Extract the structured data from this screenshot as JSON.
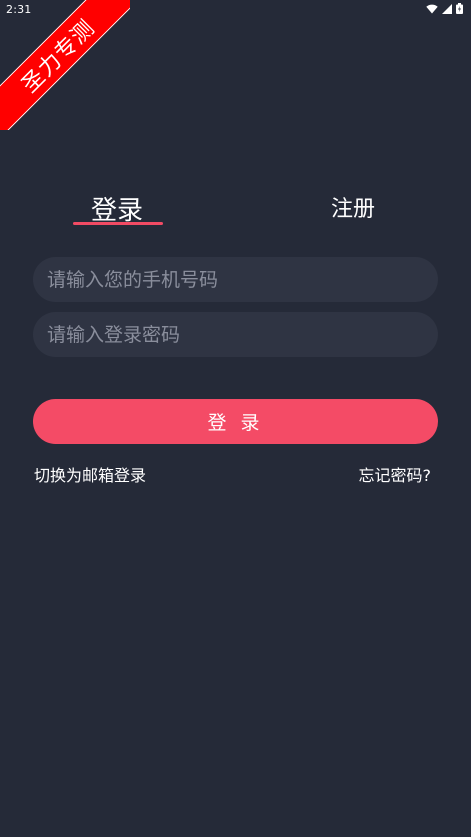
{
  "status_bar": {
    "time": "2:31",
    "icons": [
      "wifi-icon",
      "signal-icon",
      "battery-icon"
    ]
  },
  "ribbon": {
    "text": "圣力专测",
    "color": "#ff0000"
  },
  "tabs": {
    "login_label": "登录",
    "register_label": "注册",
    "active": "login"
  },
  "form": {
    "phone_placeholder": "请输入您的手机号码",
    "phone_value": "",
    "password_placeholder": "请输入登录密码",
    "password_value": ""
  },
  "login_button": {
    "label": "登 录"
  },
  "links": {
    "switch_email": "切换为邮箱登录",
    "forgot_password": "忘记密码?"
  },
  "colors": {
    "background": "#252a38",
    "input_background": "#2f3443",
    "accent": "#f44b66"
  }
}
